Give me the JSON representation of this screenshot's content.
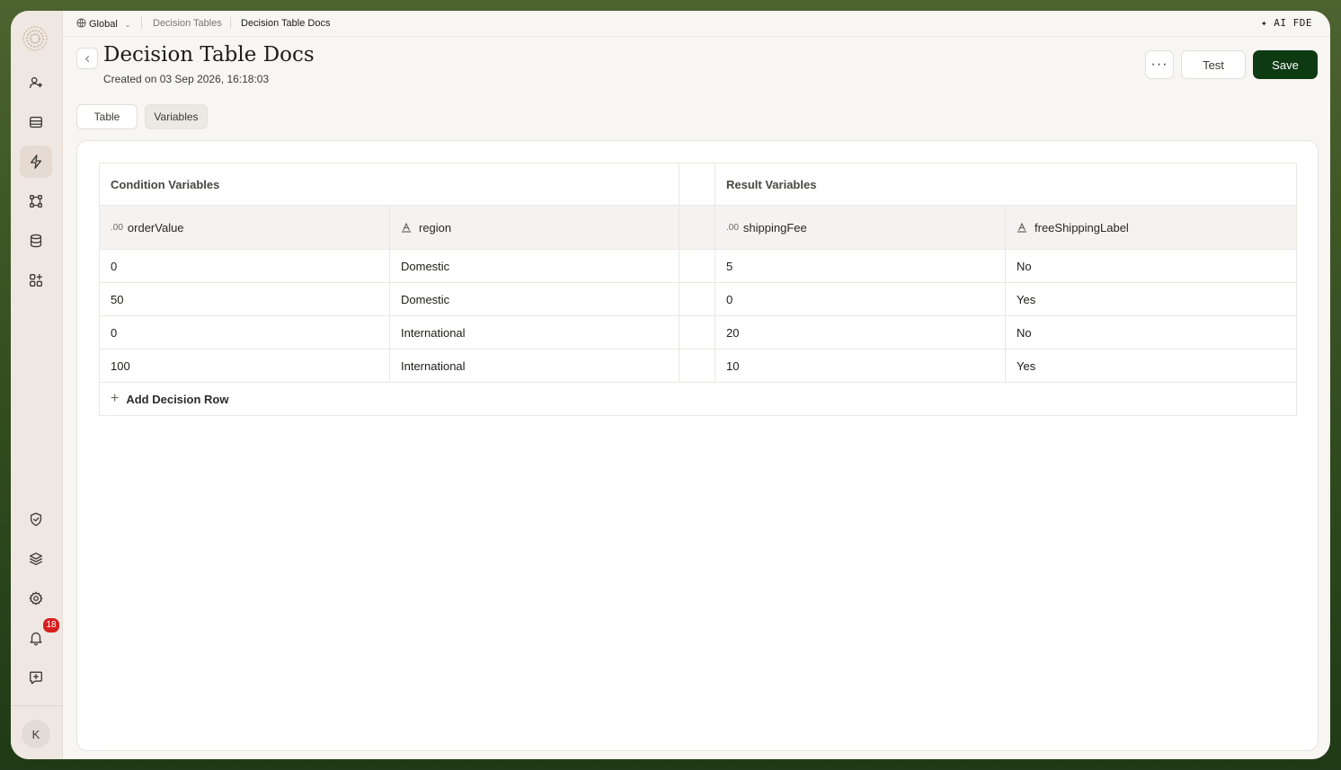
{
  "topbar": {
    "scope": "Global",
    "breadcrumb_parent": "Decision Tables",
    "breadcrumb_current": "Decision Table Docs",
    "ai_label": "AI FDE"
  },
  "header": {
    "title": "Decision Table Docs",
    "subtitle": "Created on 03 Sep 2026, 16:18:03",
    "more_label": "···",
    "test_label": "Test",
    "save_label": "Save"
  },
  "tabs": [
    {
      "label": "Table",
      "active": false
    },
    {
      "label": "Variables",
      "active": true
    }
  ],
  "sidebar": {
    "items": [
      "users",
      "table",
      "zap",
      "workflow",
      "database",
      "apps"
    ],
    "bottom_items": [
      "shield",
      "layers",
      "settings",
      "notifications",
      "feedback"
    ],
    "notification_count": "18",
    "avatar_initial": "K"
  },
  "table": {
    "condition_group": "Condition Variables",
    "result_group": "Result Variables",
    "columns": {
      "c1": {
        "name": "orderValue",
        "type": ".00"
      },
      "c2": {
        "name": "region",
        "type": "text"
      },
      "r1": {
        "name": "shippingFee",
        "type": ".00"
      },
      "r2": {
        "name": "freeShippingLabel",
        "type": "text"
      }
    },
    "rows": [
      [
        "0",
        "Domestic",
        "5",
        "No"
      ],
      [
        "50",
        "Domestic",
        "0",
        "Yes"
      ],
      [
        "0",
        "International",
        "20",
        "No"
      ],
      [
        "100",
        "International",
        "10",
        "Yes"
      ]
    ],
    "add_row_label": "Add Decision Row"
  },
  "colors": {
    "save_bg": "#0e3a12",
    "badge": "#d62020",
    "sidebar_bg": "#efe7e1"
  }
}
